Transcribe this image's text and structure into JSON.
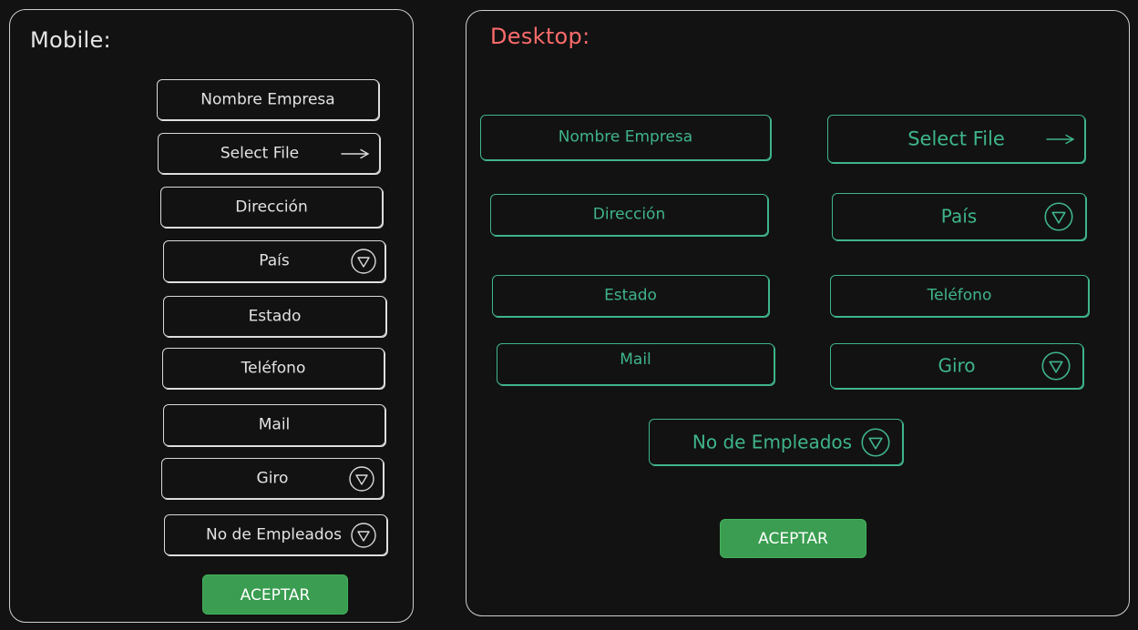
{
  "colors": {
    "background": "#121212",
    "mobile_stroke": "#d9d9d9",
    "desktop_stroke": "#3fb58a",
    "desktop_title": "#ff6b6b",
    "accept_fill": "#3a9d51"
  },
  "mobile": {
    "title": "Mobile:",
    "fields": [
      {
        "label": "Nombre Empresa"
      },
      {
        "label": "Select File",
        "icon": "arrow-right-icon"
      },
      {
        "label": "Dirección"
      },
      {
        "label": "País",
        "icon": "dropdown-icon"
      },
      {
        "label": "Estado"
      },
      {
        "label": "Teléfono"
      },
      {
        "label": "Mail"
      },
      {
        "label": "Giro",
        "icon": "dropdown-icon"
      },
      {
        "label": "No de Empleados",
        "icon": "dropdown-icon"
      }
    ],
    "accept_label": "ACEPTAR"
  },
  "desktop": {
    "title": "Desktop:",
    "fields": [
      {
        "label": "Nombre Empresa"
      },
      {
        "label": "Select File",
        "icon": "arrow-right-icon"
      },
      {
        "label": "Dirección"
      },
      {
        "label": "País",
        "icon": "dropdown-icon"
      },
      {
        "label": "Estado"
      },
      {
        "label": "Teléfono"
      },
      {
        "label": "Mail"
      },
      {
        "label": "Giro",
        "icon": "dropdown-icon"
      },
      {
        "label": "No de Empleados",
        "icon": "dropdown-icon"
      }
    ],
    "accept_label": "ACEPTAR"
  }
}
